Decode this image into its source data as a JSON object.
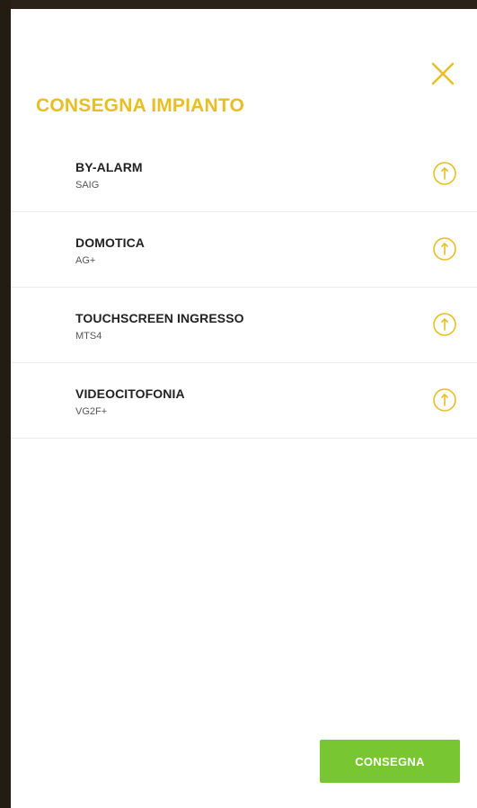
{
  "panel": {
    "title": "CONSEGNA IMPIANTO",
    "close_icon": "close-icon",
    "accent_color": "#e8be24"
  },
  "devices": [
    {
      "name": "BY-ALARM",
      "code": "SAIG",
      "icon": "info-circle-icon"
    },
    {
      "name": "DOMOTICA",
      "code": "AG+",
      "icon": "info-circle-icon"
    },
    {
      "name": "TOUCHSCREEN INGRESSO",
      "code": "MTS4",
      "icon": "info-circle-icon"
    },
    {
      "name": "VIDEOCITOFONIA",
      "code": "VG2F+",
      "icon": "info-circle-icon"
    }
  ],
  "footer": {
    "submit_label": "CONSEGNA",
    "submit_color": "#78c631"
  }
}
